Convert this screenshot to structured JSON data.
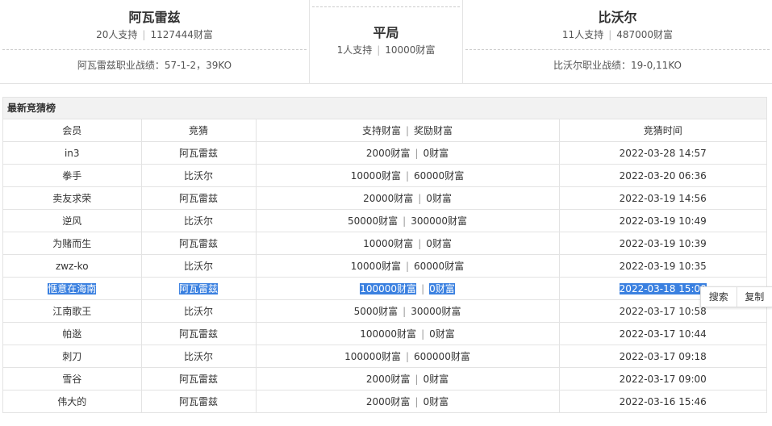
{
  "matchup": {
    "left": {
      "name": "阿瓦雷兹",
      "supporters": "20人支持",
      "wealth": "1127444财富",
      "record": "阿瓦雷兹职业战绩：57-1-2，39KO"
    },
    "draw": {
      "name": "平局",
      "supporters": "1人支持",
      "wealth": "10000财富"
    },
    "right": {
      "name": "比沃尔",
      "supporters": "11人支持",
      "wealth": "487000财富",
      "record": "比沃尔职业战绩：19-0,11KO"
    }
  },
  "board": {
    "title": "最新竞猜榜",
    "columns": {
      "member": "会员",
      "pick": "竞猜",
      "stake": "支持财富",
      "reward": "奖励财富",
      "time": "竞猜时间"
    },
    "rows": [
      {
        "member": "in3",
        "pick": "阿瓦雷兹",
        "stake": "2000财富",
        "reward": "0财富",
        "time": "2022-03-28 14:57"
      },
      {
        "member": "拳手",
        "pick": "比沃尔",
        "stake": "10000财富",
        "reward": "60000财富",
        "time": "2022-03-20 06:36"
      },
      {
        "member": "卖友求荣",
        "pick": "阿瓦雷兹",
        "stake": "20000财富",
        "reward": "0财富",
        "time": "2022-03-19 14:56"
      },
      {
        "member": "逆风",
        "pick": "比沃尔",
        "stake": "50000财富",
        "reward": "300000财富",
        "time": "2022-03-19 10:49"
      },
      {
        "member": "为赌而生",
        "pick": "阿瓦雷兹",
        "stake": "10000财富",
        "reward": "0财富",
        "time": "2022-03-19 10:39"
      },
      {
        "member": "zwz-ko",
        "pick": "比沃尔",
        "stake": "10000财富",
        "reward": "60000财富",
        "time": "2022-03-19 10:35"
      },
      {
        "member": "惬意在海南",
        "pick": "阿瓦雷兹",
        "stake": "100000财富",
        "reward": "0财富",
        "time": "2022-03-18 15:00"
      },
      {
        "member": "江南歌王",
        "pick": "比沃尔",
        "stake": "5000财富",
        "reward": "30000财富",
        "time": "2022-03-17 10:58"
      },
      {
        "member": "帕逖",
        "pick": "阿瓦雷兹",
        "stake": "100000财富",
        "reward": "0财富",
        "time": "2022-03-17 10:44"
      },
      {
        "member": "刺刀",
        "pick": "比沃尔",
        "stake": "100000财富",
        "reward": "600000财富",
        "time": "2022-03-17 09:18"
      },
      {
        "member": "雪谷",
        "pick": "阿瓦雷兹",
        "stake": "2000财富",
        "reward": "0财富",
        "time": "2022-03-17 09:00"
      },
      {
        "member": "伟大的",
        "pick": "阿瓦雷兹",
        "stake": "2000财富",
        "reward": "0财富",
        "time": "2022-03-16 15:46"
      }
    ]
  },
  "context_menu": {
    "search": "搜索",
    "copy": "复制"
  },
  "colors": {
    "selection": "#3a80e0",
    "border": "#e3e3e3",
    "header_bg": "#f2f2f2"
  }
}
